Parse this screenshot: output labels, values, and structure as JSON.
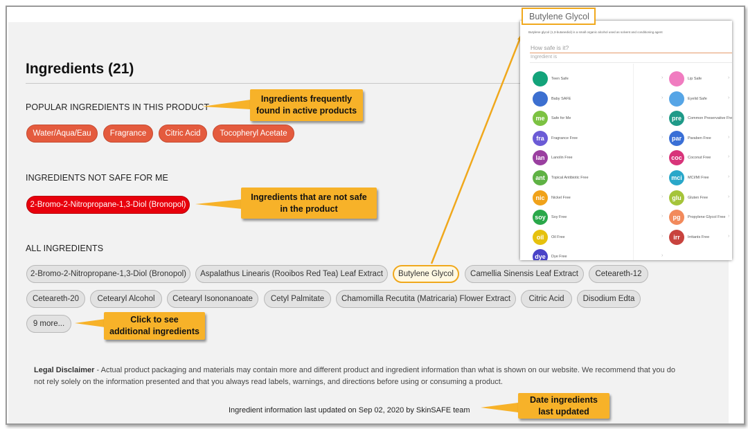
{
  "page": {
    "title": "Ingredients (21)"
  },
  "popular": {
    "heading": "POPULAR INGREDIENTS IN THIS PRODUCT",
    "items": [
      "Water/Aqua/Eau",
      "Fragrance",
      "Citric Acid",
      "Tocopheryl Acetate"
    ]
  },
  "unsafe": {
    "heading": "INGREDIENTS NOT SAFE FOR ME",
    "items": [
      "2-Bromo-2-Nitropropane-1,3-Diol (Bronopol)"
    ]
  },
  "all": {
    "heading": "ALL INGREDIENTS",
    "row1": [
      "2-Bromo-2-Nitropropane-1,3-Diol (Bronopol)",
      "Aspalathus Linearis (Rooibos Red Tea) Leaf Extract",
      "Butylene Glycol",
      "Camellia Sinensis Leaf Extract",
      "Ceteareth-12"
    ],
    "row2": [
      "Ceteareth-20",
      "Cetearyl Alcohol",
      "Cetearyl Isononanoate",
      "Cetyl Palmitate",
      "Chamomilla Recutita (Matricaria) Flower Extract",
      "Citric Acid",
      "Disodium Edta"
    ],
    "more": "9 more..."
  },
  "callouts": {
    "popular": "Ingredients frequently found in active products",
    "unsafe": "Ingredients that are not safe in the product",
    "more": "Click to see additional ingredients",
    "date": "Date ingredients last updated"
  },
  "disclaimer": {
    "label": "Legal Disclaimer",
    "text": " - Actual product packaging and materials may contain more and different product and ingredient information than what is shown on our website. We recommend that you do not rely solely on the information presented and that you always read labels, warnings, and directions before using or consuming a product."
  },
  "footer": {
    "text": "Ingredient information last updated on Sep 02, 2020 by SkinSAFE team"
  },
  "inset": {
    "title": "Butylene Glycol",
    "description": "Butylene glycol (1,3-butanediol) is a small organic alcohol used as solvent and conditioning agent",
    "question": "How safe is it?",
    "subheading": "Ingredient is",
    "left_items": [
      {
        "label": "Teen Safe",
        "badge": "",
        "color": "#13a37a"
      },
      {
        "label": "Baby SAFE",
        "badge": "",
        "color": "#3c6fd0"
      },
      {
        "label": "Safe for Me",
        "badge": "me",
        "color": "#7cc242"
      },
      {
        "label": "Fragrance Free",
        "badge": "fra",
        "color": "#6b5bd6"
      },
      {
        "label": "Lanolin Free",
        "badge": "lan",
        "color": "#9a3fa0"
      },
      {
        "label": "Topical Antibiotic Free",
        "badge": "ant",
        "color": "#5fb244"
      },
      {
        "label": "Nickel Free",
        "badge": "nic",
        "color": "#f0a21a"
      },
      {
        "label": "Soy Free",
        "badge": "soy",
        "color": "#2aa84a"
      },
      {
        "label": "Oil Free",
        "badge": "oil",
        "color": "#e6c10e"
      },
      {
        "label": "Dye Free",
        "badge": "dye",
        "color": "#4a43c8"
      }
    ],
    "right_items": [
      {
        "label": "Lip Safe",
        "badge": "",
        "color": "#f07cc0"
      },
      {
        "label": "Eyelid Safe",
        "badge": "",
        "color": "#56a5e6"
      },
      {
        "label": "Common Preservative Free",
        "badge": "pre",
        "color": "#1f9a88"
      },
      {
        "label": "Paraben Free",
        "badge": "par",
        "color": "#3a6fd6"
      },
      {
        "label": "Coconut Free",
        "badge": "coc",
        "color": "#d8347a"
      },
      {
        "label": "MCI/MI Free",
        "badge": "mci",
        "color": "#29a7c9"
      },
      {
        "label": "Gluten Free",
        "badge": "glu",
        "color": "#a5c43a"
      },
      {
        "label": "Propylene Glycol Free",
        "badge": "pg",
        "color": "#f28a5c"
      },
      {
        "label": "Irritants Free",
        "badge": "irr",
        "color": "#c8433e"
      }
    ]
  },
  "colors": {
    "popular_pill": "#e45b3e",
    "unsafe_pill": "#e8000c",
    "callout": "#f7b229",
    "highlight": "#f0a81c"
  }
}
